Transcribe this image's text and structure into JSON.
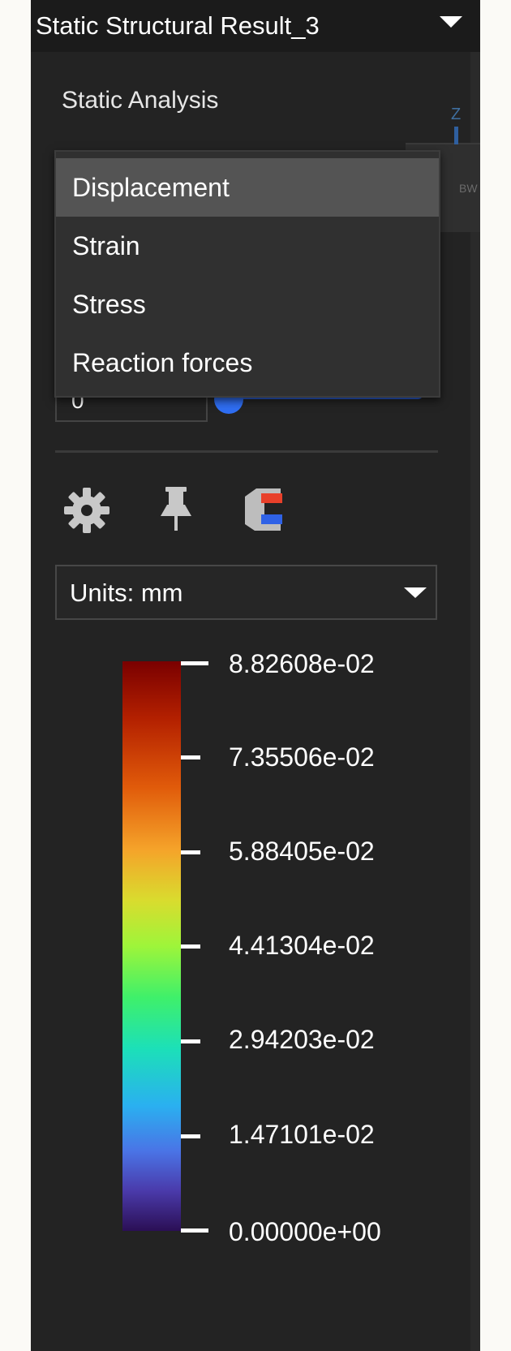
{
  "header": {
    "title": "Static Structural Result_3"
  },
  "viewport": {
    "axis_label": "Z",
    "cube_label": "BW"
  },
  "section": {
    "label": "Static Analysis"
  },
  "step": {
    "value": "0"
  },
  "result_menu": {
    "items": [
      {
        "label": "Displacement",
        "selected": true
      },
      {
        "label": "Strain",
        "selected": false
      },
      {
        "label": "Stress",
        "selected": false
      },
      {
        "label": "Reaction forces",
        "selected": false
      }
    ]
  },
  "toolbar": {
    "icons": [
      "gear-icon",
      "pin-icon",
      "magnet-icon"
    ]
  },
  "units": {
    "label": "Units: mm"
  },
  "legend": {
    "labels": [
      "8.82608e-02",
      "7.35506e-02",
      "5.88405e-02",
      "4.41304e-02",
      "2.94203e-02",
      "1.47101e-02",
      "0.00000e+00"
    ]
  },
  "colors": {
    "panel": "#232323",
    "menu_bg": "#303030",
    "menu_selected": "#545454",
    "slider": "#2f6ef2"
  }
}
